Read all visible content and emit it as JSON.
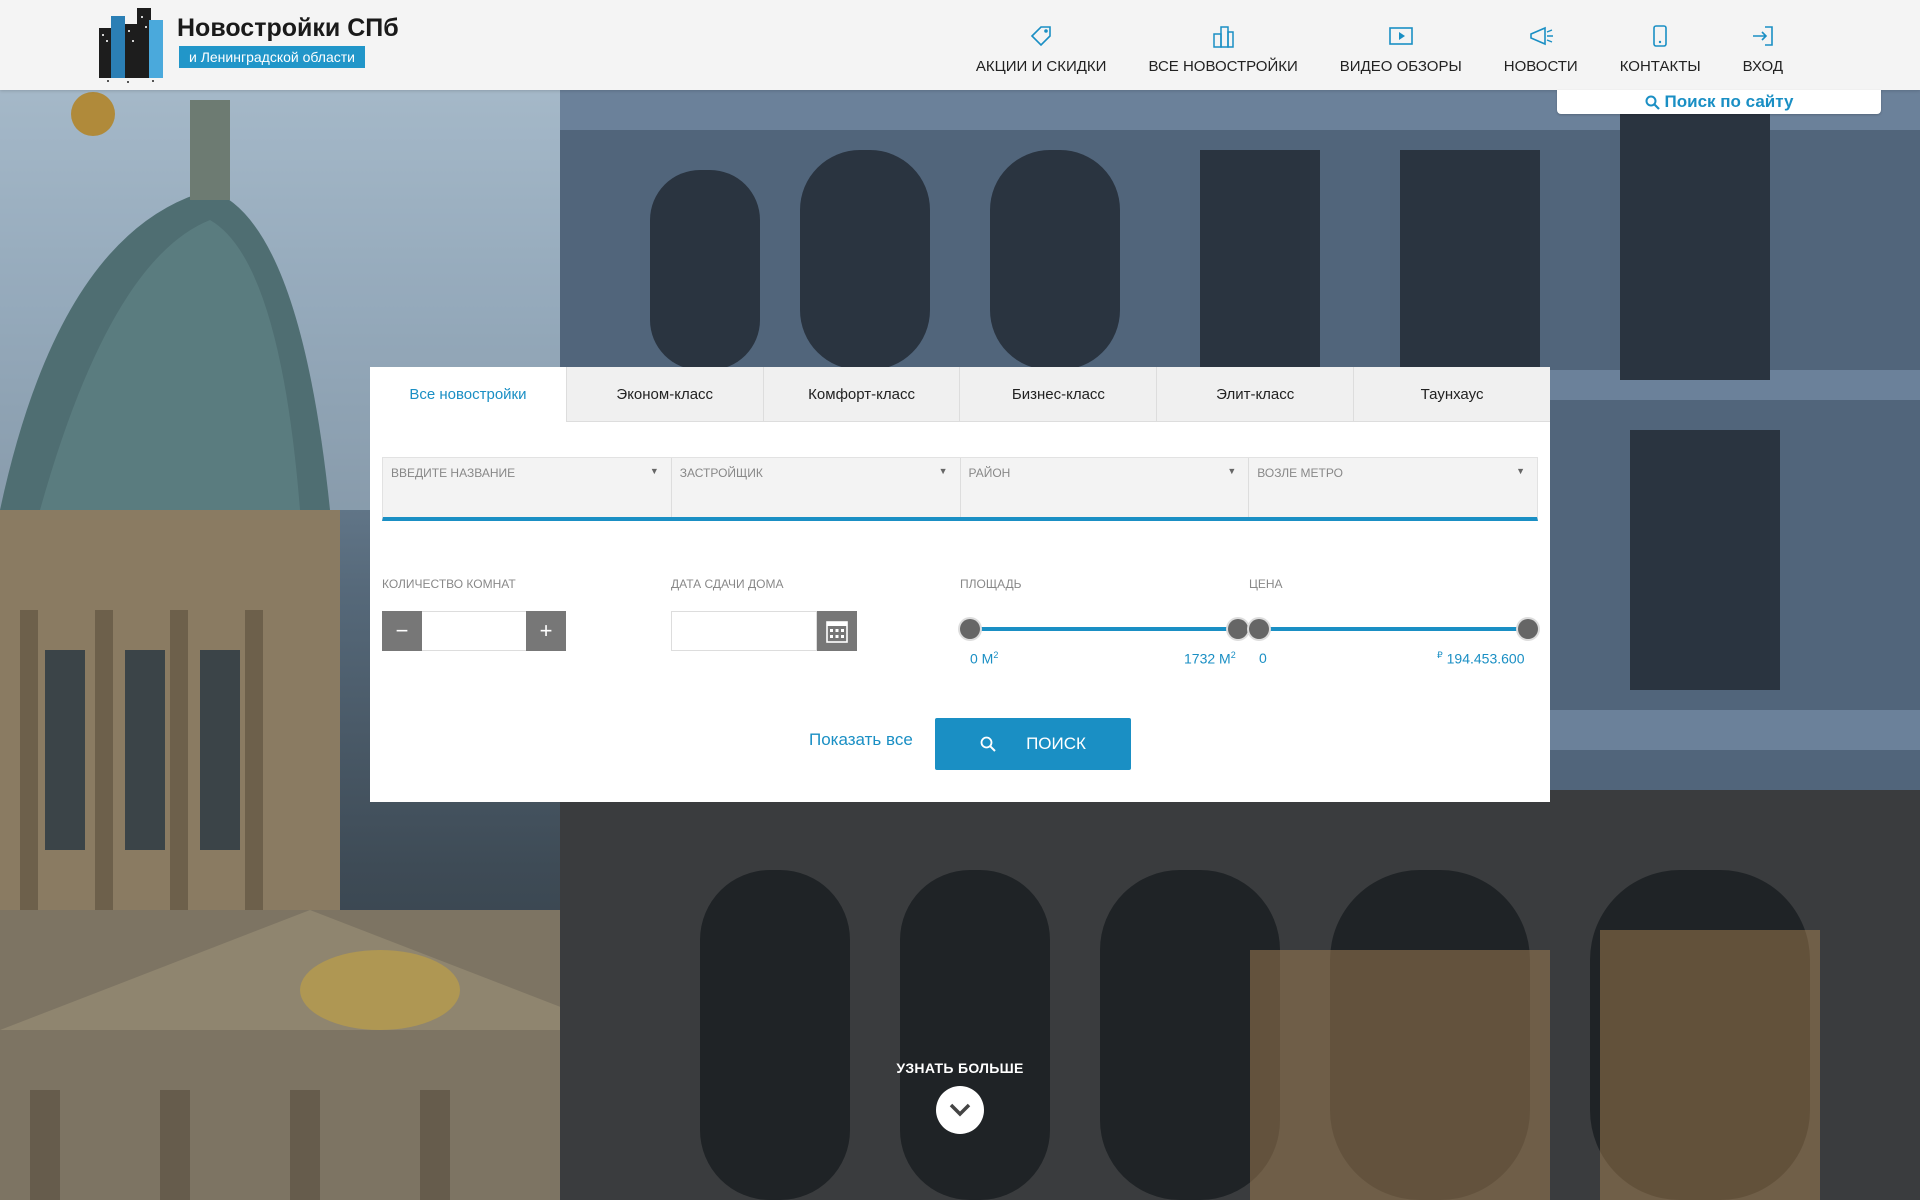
{
  "header": {
    "logo_title": "Новостройки СПб",
    "logo_subtitle": "и Ленинградской области",
    "nav": [
      {
        "label": "АКЦИИ И СКИДКИ",
        "icon": "tag-icon"
      },
      {
        "label": "ВСЕ НОВОСТРОЙКИ",
        "icon": "buildings-icon"
      },
      {
        "label": "ВИДЕО ОБЗОРЫ",
        "icon": "video-play-icon"
      },
      {
        "label": "НОВОСТИ",
        "icon": "megaphone-icon"
      },
      {
        "label": "КОНТАКТЫ",
        "icon": "phone-icon"
      },
      {
        "label": "ВХОД",
        "icon": "login-icon"
      }
    ],
    "site_search": "Поиск по сайту"
  },
  "panel": {
    "tabs": [
      "Все новостройки",
      "Эконом-класс",
      "Комфорт-класс",
      "Бизнес-класс",
      "Элит-класс",
      "Таунхаус"
    ],
    "active_tab": 0,
    "filters": [
      "ВВЕДИТЕ НАЗВАНИЕ",
      "ЗАСТРОЙЩИК",
      "РАЙОН",
      "ВОЗЛЕ МЕТРО"
    ],
    "rooms_label": "КОЛИЧЕСТВО КОМНАТ",
    "rooms_value": "",
    "date_label": "ДАТА СДАЧИ ДОМА",
    "date_value": "",
    "area_label": "ПЛОЩАДЬ",
    "area_min": "0 М",
    "area_max": "1732 М",
    "area_unit_sup": "2",
    "price_label": "ЦЕНА",
    "price_min": "0",
    "price_max": "194.453.600",
    "price_currency": "₽",
    "show_all": "Показать все",
    "search_button": "ПОИСК"
  },
  "learn_more": "УЗНАТЬ БОЛЬШЕ",
  "colors": {
    "accent": "#1a8fc4",
    "header_bg": "#f4f4f4"
  }
}
